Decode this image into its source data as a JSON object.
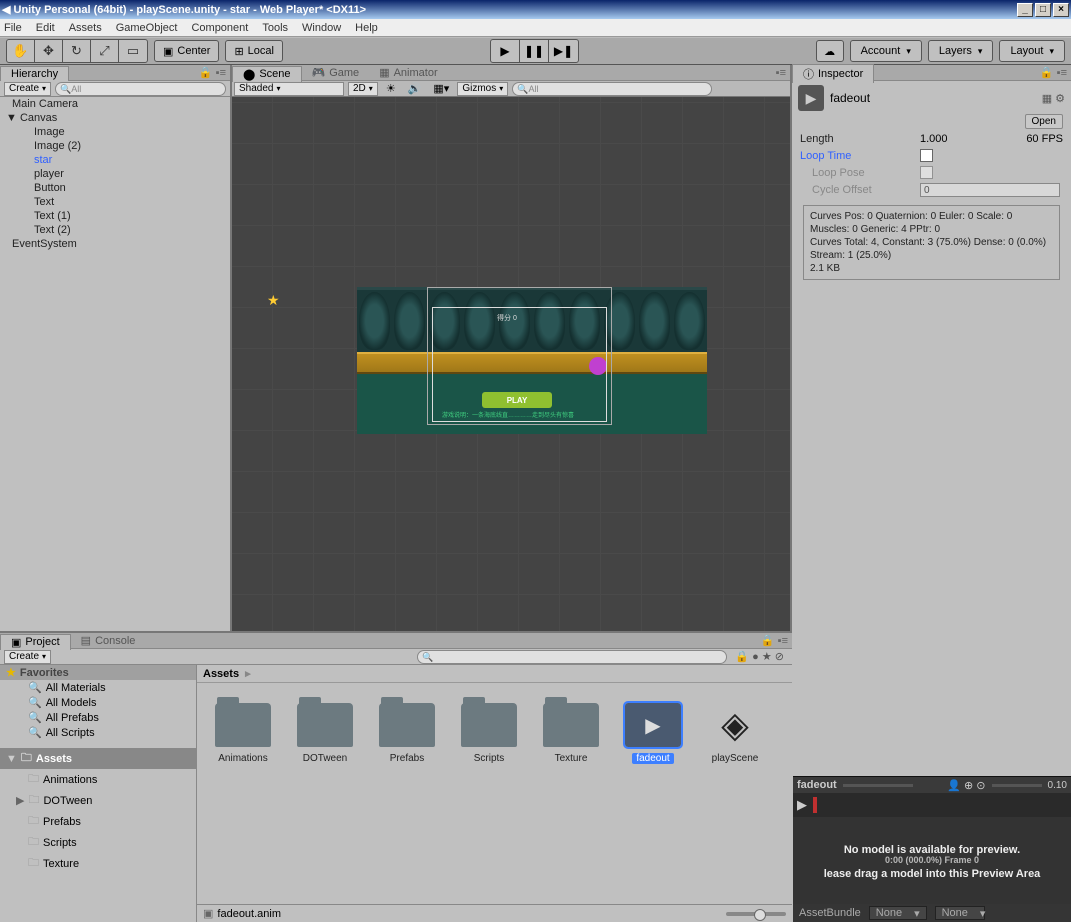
{
  "titlebar": {
    "title": "Unity Personal (64bit) - playScene.unity - star - Web Player* <DX11>",
    "min": "_",
    "max": "□",
    "close": "×"
  },
  "menubar": [
    "File",
    "Edit",
    "Assets",
    "GameObject",
    "Component",
    "Tools",
    "Window",
    "Help"
  ],
  "toolbar": {
    "center": "Center",
    "local": "Local",
    "account": "Account",
    "layers": "Layers",
    "layout": "Layout"
  },
  "hierarchy": {
    "tab": "Hierarchy",
    "create": "Create",
    "items": [
      {
        "text": "Main Camera",
        "indent": 0
      },
      {
        "text": "Canvas",
        "indent": 0,
        "arrow": "▼"
      },
      {
        "text": "Image",
        "indent": 1
      },
      {
        "text": "Image (2)",
        "indent": 1
      },
      {
        "text": "star",
        "indent": 1,
        "blue": true
      },
      {
        "text": "player",
        "indent": 1
      },
      {
        "text": "Button",
        "indent": 1
      },
      {
        "text": "Text",
        "indent": 1
      },
      {
        "text": "Text (1)",
        "indent": 1
      },
      {
        "text": "Text (2)",
        "indent": 1
      },
      {
        "text": "EventSystem",
        "indent": 0
      }
    ]
  },
  "scene": {
    "tabs": [
      "Scene",
      "Game",
      "Animator"
    ],
    "shaded": "Shaded",
    "mode2d": "2D",
    "gizmos": "Gizmos",
    "play_label": "PLAY",
    "score": "得分 0"
  },
  "inspector": {
    "tab": "Inspector",
    "asset": "fadeout",
    "open": "Open",
    "length_lbl": "Length",
    "length_val": "1.000",
    "fps": "60 FPS",
    "loop_time": "Loop Time",
    "loop_pose": "Loop Pose",
    "cycle": "Cycle Offset",
    "cycle_val": "0",
    "curves": "Curves Pos: 0 Quaternion: 0 Euler: 0 Scale: 0\nMuscles: 0 Generic: 4 PPtr: 0\nCurves Total: 4, Constant: 3 (75.0%) Dense: 0 (0.0%) Stream: 1 (25.0%)\n2.1 KB"
  },
  "project": {
    "tab": "Project",
    "console": "Console",
    "create": "Create",
    "favorites": "Favorites",
    "favs": [
      "All Materials",
      "All Models",
      "All Prefabs",
      "All Scripts"
    ],
    "assets_lbl": "Assets",
    "tree": [
      "Animations",
      "DOTween",
      "Prefabs",
      "Scripts",
      "Texture"
    ],
    "crumb": "Assets",
    "assets": [
      {
        "name": "Animations",
        "type": "folder"
      },
      {
        "name": "DOTween",
        "type": "folder"
      },
      {
        "name": "Prefabs",
        "type": "folder"
      },
      {
        "name": "Scripts",
        "type": "folder"
      },
      {
        "name": "Texture",
        "type": "folder"
      },
      {
        "name": "fadeout",
        "type": "anim",
        "sel": true
      },
      {
        "name": "playScene",
        "type": "scene"
      }
    ],
    "footer": "fadeout.anim"
  },
  "preview": {
    "name": "fadeout",
    "time": "0.10",
    "msg1": "No model is available for preview.",
    "msg2": "lease drag a model into this Preview Area",
    "frame": "0:00 (000.0%) Frame 0",
    "ab": "AssetBundle",
    "none": "None"
  }
}
